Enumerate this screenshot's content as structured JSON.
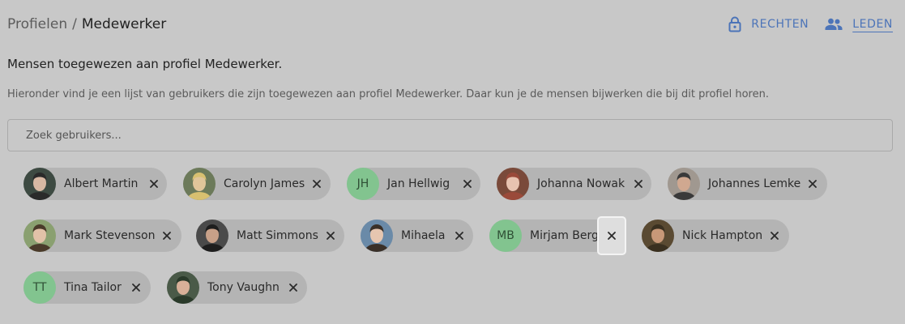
{
  "breadcrumb": {
    "parent": "Profielen",
    "separator": "/",
    "current": "Medewerker"
  },
  "tabs": [
    {
      "label": "RECHTEN",
      "icon": "lock-icon",
      "active": false
    },
    {
      "label": "LEDEN",
      "icon": "people-icon",
      "active": true
    }
  ],
  "heading": "Mensen toegewezen aan profiel Medewerker.",
  "description": "Hieronder vind je een lijst van gebruikers die zijn toegewezen aan profiel Medewerker. Daar kun je de mensen bijwerken die bij dit profiel horen.",
  "search": {
    "placeholder": "Zoek gebruikers...",
    "value": ""
  },
  "members": [
    {
      "name": "Albert Martin",
      "avatar_type": "photo"
    },
    {
      "name": "Carolyn James",
      "avatar_type": "photo"
    },
    {
      "name": "Jan Hellwig",
      "avatar_type": "initials",
      "initials": "JH"
    },
    {
      "name": "Johanna Nowak",
      "avatar_type": "photo"
    },
    {
      "name": "Johannes Lemke",
      "avatar_type": "photo"
    },
    {
      "name": "Mark Stevenson",
      "avatar_type": "photo"
    },
    {
      "name": "Matt Simmons",
      "avatar_type": "photo"
    },
    {
      "name": "Mihaela",
      "avatar_type": "photo"
    },
    {
      "name": "Mirjam Berg",
      "avatar_type": "initials",
      "initials": "MB",
      "remove_focused": true
    },
    {
      "name": "Nick Hampton",
      "avatar_type": "photo"
    },
    {
      "name": "Tina Tailor",
      "avatar_type": "initials",
      "initials": "TT"
    },
    {
      "name": "Tony Vaughn",
      "avatar_type": "photo"
    }
  ],
  "colors": {
    "accent": "#4c74b8",
    "chip": "#b4b4b4",
    "initials_avatar": "#82c48f",
    "background": "#c8c8c8"
  }
}
